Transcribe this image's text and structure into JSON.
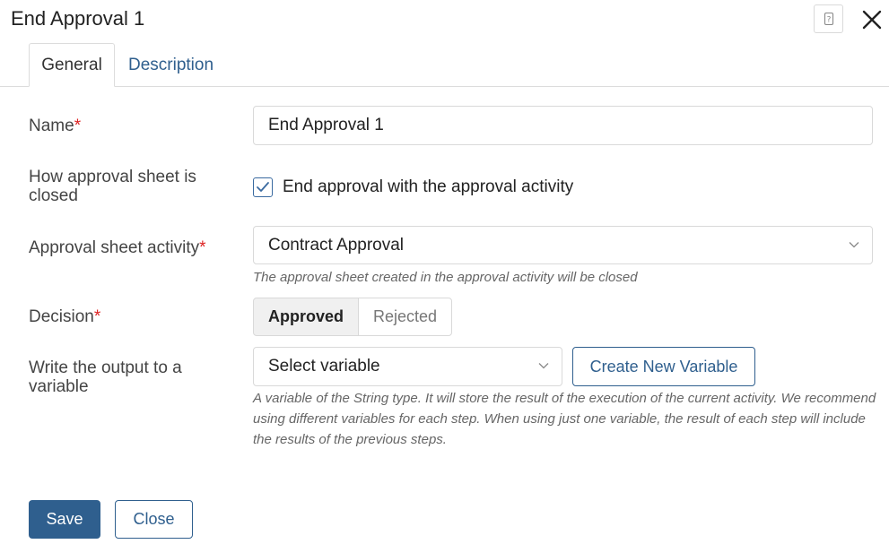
{
  "dialog": {
    "title": "End Approval 1",
    "help_icon": "help-question-icon",
    "close_icon": "close-x-icon"
  },
  "tabs": [
    {
      "label": "General",
      "active": true
    },
    {
      "label": "Description",
      "active": false
    }
  ],
  "form": {
    "name": {
      "label": "Name",
      "required_mark": "*",
      "value": "End Approval 1"
    },
    "closing": {
      "label": "How approval sheet is closed",
      "checkbox_label": "End approval with the approval activity",
      "checked": true
    },
    "activity": {
      "label": "Approval sheet activity",
      "required_mark": "*",
      "value": "Contract Approval",
      "hint": "The approval sheet created in the approval activity will be closed"
    },
    "decision": {
      "label": "Decision",
      "required_mark": "*",
      "options": [
        "Approved",
        "Rejected"
      ],
      "selected": "Approved"
    },
    "output": {
      "label": "Write the output to a variable",
      "select_value": "Select variable",
      "create_button": "Create New Variable",
      "hint": "A variable of the String type. It will store the result of the execution of the current activity. We recommend using different variables for each step. When using just one variable, the result of each step will include the results of the previous steps."
    }
  },
  "footer": {
    "save_label": "Save",
    "close_label": "Close"
  },
  "colors": {
    "accent": "#2f5f8e",
    "required": "#dd2222",
    "border": "#d9d9d9"
  }
}
